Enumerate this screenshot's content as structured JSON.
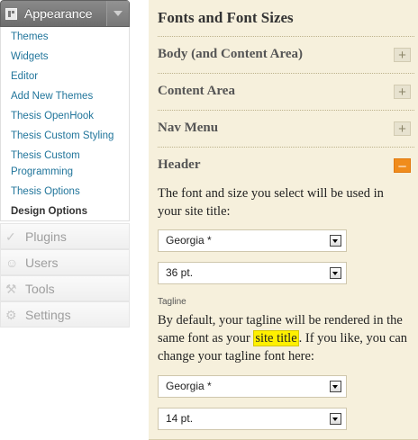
{
  "sidebar": {
    "header": {
      "label": "Appearance",
      "icon": "appearance-icon"
    },
    "submenu": [
      {
        "label": "Themes"
      },
      {
        "label": "Widgets"
      },
      {
        "label": "Editor"
      },
      {
        "label": "Add New Themes"
      },
      {
        "label": "Thesis OpenHook"
      },
      {
        "label": "Thesis Custom Styling"
      },
      {
        "label": "Thesis Custom",
        "label2": "Programming"
      },
      {
        "label": "Thesis Options"
      },
      {
        "label": "Design Options",
        "current": true
      }
    ],
    "menu": [
      {
        "label": "Plugins",
        "icon": "plugins-icon"
      },
      {
        "label": "Users",
        "icon": "users-icon"
      },
      {
        "label": "Tools",
        "icon": "tools-icon"
      },
      {
        "label": "Settings",
        "icon": "settings-icon"
      }
    ]
  },
  "panel": {
    "title": "Fonts and Font Sizes",
    "sections": [
      {
        "title": "Body (and Content Area)",
        "toggle": "+"
      },
      {
        "title": "Content Area",
        "toggle": "+"
      },
      {
        "title": "Nav Menu",
        "toggle": "+"
      },
      {
        "title": "Header",
        "toggle": "–"
      }
    ],
    "header_section": {
      "description": "The font and size you select will be used in your site title:",
      "title_font_select": "Georgia *",
      "title_size_select": "36 pt.",
      "tagline_label": "Tagline",
      "tagline_desc_before": "By default, your tagline will be rendered in the same font as your ",
      "tagline_desc_highlight": "site title",
      "tagline_desc_after": ". If you like, you can change your tagline font here:",
      "tagline_font_select": "Georgia *",
      "tagline_size_select": "14 pt."
    }
  },
  "colors": {
    "link": "#21759b",
    "panel_background": "#f6f0dc",
    "toggle_active": "#f08c1c",
    "highlight": "#fff000"
  }
}
